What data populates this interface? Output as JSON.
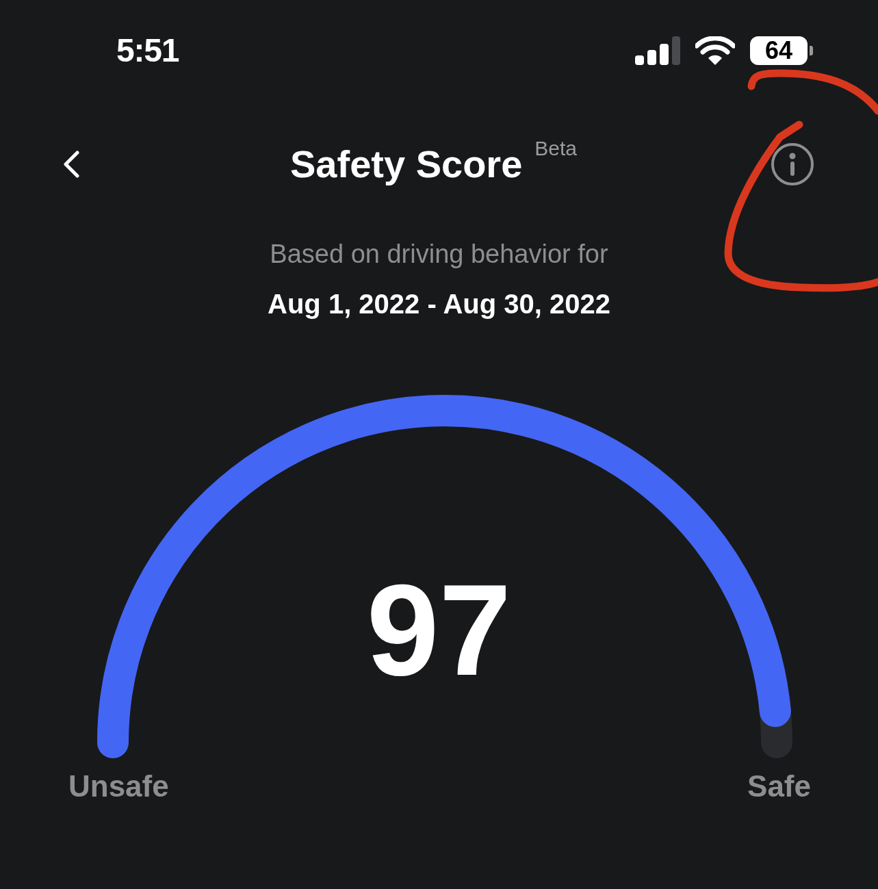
{
  "status_bar": {
    "time": "5:51",
    "battery": "64"
  },
  "header": {
    "title": "Safety Score",
    "badge": "Beta"
  },
  "period": {
    "caption": "Based on driving behavior for",
    "range": "Aug 1, 2022 - Aug 30, 2022"
  },
  "gauge": {
    "score": "97",
    "min_label": "Unsafe",
    "max_label": "Safe"
  }
}
